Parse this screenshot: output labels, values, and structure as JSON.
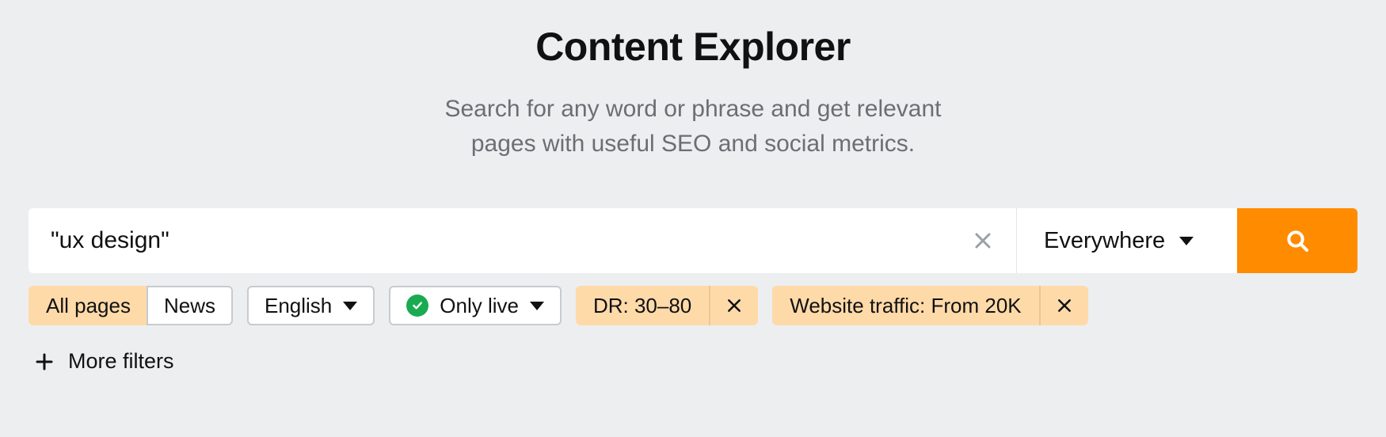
{
  "header": {
    "title": "Content Explorer",
    "subtitle_line1": "Search for any word or phrase and get relevant",
    "subtitle_line2": "pages with useful SEO and social metrics."
  },
  "search": {
    "value": "\"ux design\"",
    "scope": "Everywhere"
  },
  "filters": {
    "tabs": {
      "all_pages": "All pages",
      "news": "News"
    },
    "language": "English",
    "only_live": "Only live",
    "chips": [
      {
        "label": "DR: 30–80"
      },
      {
        "label": "Website traffic: From 20K"
      }
    ],
    "more": "More filters"
  }
}
